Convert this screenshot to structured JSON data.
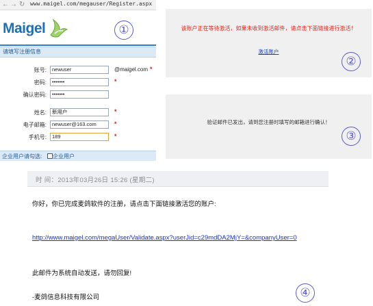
{
  "browser": {
    "url": "www.maigel.com/megauser/Register.aspx"
  },
  "register": {
    "logo": "Maigel",
    "header": "请填写注册信息",
    "fields": [
      {
        "label": "账号:",
        "value": "newuser",
        "suffix": "@maigel.com",
        "required": "*"
      },
      {
        "label": "密码:",
        "value": "•••••••",
        "required": "*"
      },
      {
        "label": "确认密码:",
        "value": "•••••••"
      },
      {
        "label": "姓名:",
        "value": "新用户",
        "required": "*"
      },
      {
        "label": "电子邮箱:",
        "value": "newuser@163.com",
        "required": "*"
      },
      {
        "label": "手机号:",
        "value": "189",
        "required": "*"
      }
    ],
    "footer_label": "企业用户请勾选:",
    "checkbox_label": "企业用户"
  },
  "activation_notice": {
    "message": "该账户正在等待激活，如果未收到激活邮件，请点击下面链接进行激活！",
    "link": "激活账户"
  },
  "sent_notice": {
    "message": "验证邮件已发出，请到您注册时填写的邮箱进行确认！"
  },
  "email": {
    "time": "时  间：2013年03月26日 15:26 (星期二)",
    "greeting": "你好，你已完成麦鸽软件的注册，请点击下面链接激活您的账户:",
    "link": "http://www.maigel.com/megaUser/Validate.aspx?userJid=c29mdDA2MjY=&companyUser=0",
    "auto_note": "此邮件为系统自动发送，请勿回复!",
    "signature": "-麦鸽信息科技有限公司"
  },
  "markers": [
    "①",
    "②",
    "③",
    "④"
  ],
  "colors": {
    "brand_blue": "#1e6fb6",
    "required_red": "#d9231c",
    "warning_red": "#e8241c",
    "link_blue": "#1a33cc"
  }
}
